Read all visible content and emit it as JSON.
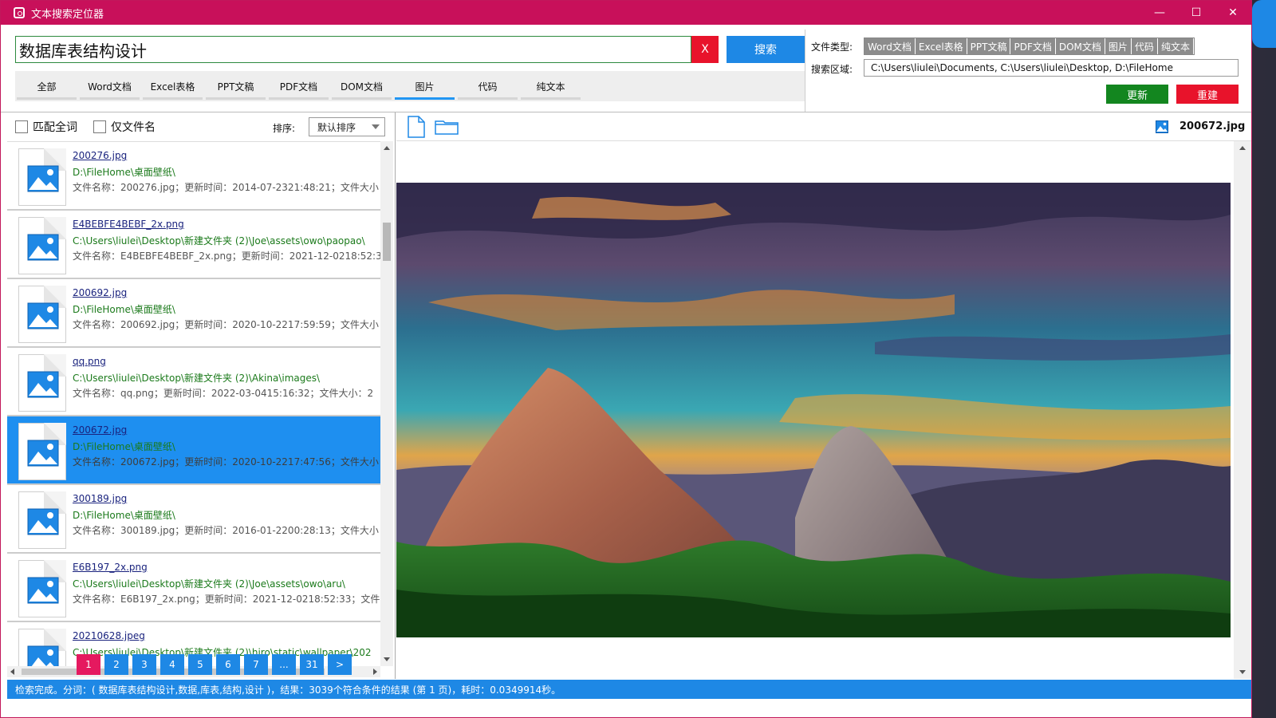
{
  "window": {
    "title": "文本搜索定位器",
    "minimize": "—",
    "maximize": "☐",
    "close": "✕"
  },
  "search": {
    "query": "数据库表结构设计",
    "clear_label": "X",
    "search_label": "搜索",
    "tabs": [
      {
        "label": "全部",
        "active": false
      },
      {
        "label": "Word文档",
        "active": false
      },
      {
        "label": "Excel表格",
        "active": false
      },
      {
        "label": "PPT文稿",
        "active": false
      },
      {
        "label": "PDF文档",
        "active": false
      },
      {
        "label": "DOM文档",
        "active": false
      },
      {
        "label": "图片",
        "active": true
      },
      {
        "label": "代码",
        "active": false
      },
      {
        "label": "纯文本",
        "active": false
      }
    ]
  },
  "settings": {
    "file_type_label": "文件类型:",
    "file_types": [
      "Word文档",
      "Excel表格",
      "PPT文稿",
      "PDF文档",
      "DOM文档",
      "图片",
      "代码",
      "纯文本"
    ],
    "region_label": "搜索区域:",
    "region_value": "C:\\Users\\liulei\\Documents, C:\\Users\\liulei\\Desktop, D:\\FileHome",
    "update_label": "更新",
    "rebuild_label": "重建"
  },
  "filters": {
    "match_whole_word": "匹配全词",
    "filename_only": "仅文件名",
    "sort_label": "排序:",
    "sort_value": "默认排序"
  },
  "results": [
    {
      "name": "200276.jpg",
      "path": "D:\\FileHome\\桌面壁纸\\",
      "meta": "文件名称：200276.jpg；更新时间：2014-07-2321:48:21；文件大小",
      "selected": false
    },
    {
      "name": "E4BEBFE4BEBF_2x.png",
      "path": "C:\\Users\\liulei\\Desktop\\新建文件夹 (2)\\Joe\\assets\\owo\\paopao\\",
      "meta": "文件名称：E4BEBFE4BEBF_2x.png；更新时间：2021-12-0218:52:3",
      "selected": false
    },
    {
      "name": "200692.jpg",
      "path": "D:\\FileHome\\桌面壁纸\\",
      "meta": "文件名称：200692.jpg；更新时间：2020-10-2217:59:59；文件大小",
      "selected": false
    },
    {
      "name": "qq.png",
      "path": "C:\\Users\\liulei\\Desktop\\新建文件夹 (2)\\Akina\\images\\",
      "meta": "文件名称：qq.png；更新时间：2022-03-0415:16:32；文件大小：2",
      "selected": false
    },
    {
      "name": "200672.jpg",
      "path": "D:\\FileHome\\桌面壁纸\\",
      "meta": "文件名称：200672.jpg；更新时间：2020-10-2217:47:56；文件大小",
      "selected": true
    },
    {
      "name": "300189.jpg",
      "path": "D:\\FileHome\\桌面壁纸\\",
      "meta": "文件名称：300189.jpg；更新时间：2016-01-2200:28:13；文件大小",
      "selected": false
    },
    {
      "name": "E6B197_2x.png",
      "path": "C:\\Users\\liulei\\Desktop\\新建文件夹 (2)\\Joe\\assets\\owo\\aru\\",
      "meta": "文件名称：E6B197_2x.png；更新时间：2021-12-0218:52:33；文件",
      "selected": false
    },
    {
      "name": "20210628.jpeg",
      "path": "C:\\Users\\liulei\\Desktop\\新建文件夹 (2)\\hiro\\static\\wallpaper\\202",
      "meta": "",
      "selected": false
    }
  ],
  "pager": {
    "pages": [
      "1",
      "2",
      "3",
      "4",
      "5",
      "6",
      "7",
      "...",
      "31",
      ">"
    ],
    "current": "1"
  },
  "preview": {
    "filename": "200672.jpg"
  },
  "status": "检索完成。分词：( 数据库表结构设计,数据,库表,结构,设计 )，结果：3039个符合条件的结果 (第 1 页)，耗时：0.0349914秒。",
  "colors": {
    "title_bar": "#c8105a",
    "accent": "#1e88e5",
    "danger": "#e8132b",
    "success": "#13861f",
    "selection": "#1e8ff0"
  }
}
